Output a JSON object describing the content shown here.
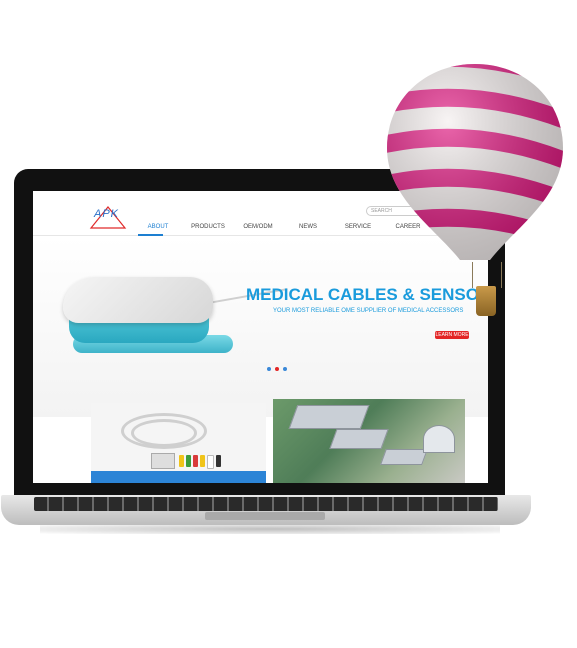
{
  "site": {
    "logo_text": "APK",
    "search_placeholder": "SEARCH",
    "nav": [
      {
        "label": "ABOUT",
        "active": true
      },
      {
        "label": "PRODUCTS",
        "active": false
      },
      {
        "label": "OEM/ODM",
        "active": false
      },
      {
        "label": "NEWS",
        "active": false
      },
      {
        "label": "SERVICE",
        "active": false
      },
      {
        "label": "CAREER",
        "active": false
      }
    ],
    "banner": {
      "headline": "MEDICAL CABLES & SENSORS",
      "subline": "YOUR MOST RELIABLE OME SUPPLIER OF MEDICAL ACCESSORS",
      "button": "LEARN MORE",
      "slide_dots": 3,
      "active_dot": 2
    }
  },
  "colors": {
    "accent_blue": "#1a9bdc",
    "button_red": "#e32626",
    "balloon_pink": "#e0157f"
  }
}
